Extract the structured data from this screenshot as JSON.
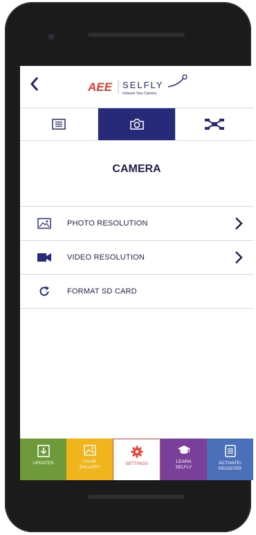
{
  "header": {
    "back_icon": "chevron-left-icon",
    "logo_brand": "AEE",
    "logo_product": "SELFLY",
    "logo_tagline": "Unleash Your Camera"
  },
  "tabs": [
    {
      "icon": "list-icon",
      "active": false
    },
    {
      "icon": "camera-icon",
      "active": true
    },
    {
      "icon": "drone-icon",
      "active": false
    }
  ],
  "section": {
    "title": "CAMERA"
  },
  "menu": [
    {
      "icon": "image-icon",
      "label": "PHOTO RESOLUTION",
      "has_arrow": true
    },
    {
      "icon": "video-camera-icon",
      "label": "VIDEO RESOLUTION",
      "has_arrow": true
    },
    {
      "icon": "refresh-icon",
      "label": "FORMAT SD CARD",
      "has_arrow": false
    }
  ],
  "bottom_nav": [
    {
      "label": "UPDATES",
      "icon": "download-icon",
      "color": "#6e9a3a",
      "active": false
    },
    {
      "label": "YOUR\nGALLERY",
      "icon": "gallery-icon",
      "color": "#f0b51c",
      "active": false
    },
    {
      "label": "SETTINGS",
      "icon": "gear-icon",
      "color": "#ffffff",
      "active": true
    },
    {
      "label": "LEARN\nSELFLY",
      "icon": "graduation-cap-icon",
      "color": "#7a3f99",
      "active": false
    },
    {
      "label": "ACTIVATE/\nREGISTER",
      "icon": "register-icon",
      "color": "#4b6fb8",
      "active": false
    }
  ],
  "colors": {
    "accent": "#262a78",
    "active_nav": "#e8473c",
    "brand_red": "#e23a2d"
  }
}
